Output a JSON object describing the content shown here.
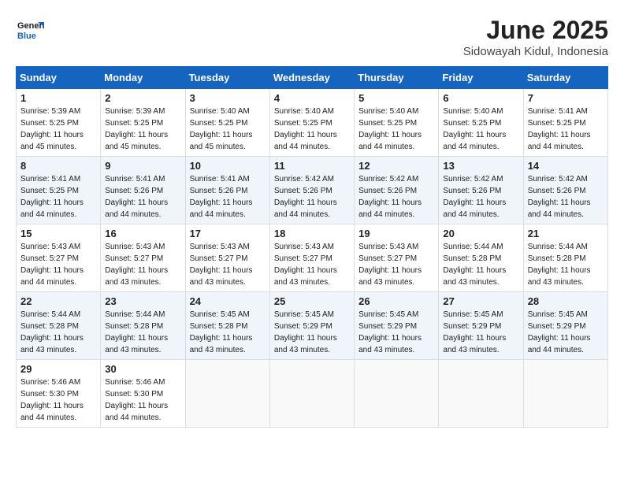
{
  "header": {
    "logo_line1": "General",
    "logo_line2": "Blue",
    "month": "June 2025",
    "location": "Sidowayah Kidul, Indonesia"
  },
  "weekdays": [
    "Sunday",
    "Monday",
    "Tuesday",
    "Wednesday",
    "Thursday",
    "Friday",
    "Saturday"
  ],
  "weeks": [
    [
      {
        "day": "1",
        "sunrise": "5:39 AM",
        "sunset": "5:25 PM",
        "daylight": "11 hours and 45 minutes."
      },
      {
        "day": "2",
        "sunrise": "5:39 AM",
        "sunset": "5:25 PM",
        "daylight": "11 hours and 45 minutes."
      },
      {
        "day": "3",
        "sunrise": "5:40 AM",
        "sunset": "5:25 PM",
        "daylight": "11 hours and 45 minutes."
      },
      {
        "day": "4",
        "sunrise": "5:40 AM",
        "sunset": "5:25 PM",
        "daylight": "11 hours and 44 minutes."
      },
      {
        "day": "5",
        "sunrise": "5:40 AM",
        "sunset": "5:25 PM",
        "daylight": "11 hours and 44 minutes."
      },
      {
        "day": "6",
        "sunrise": "5:40 AM",
        "sunset": "5:25 PM",
        "daylight": "11 hours and 44 minutes."
      },
      {
        "day": "7",
        "sunrise": "5:41 AM",
        "sunset": "5:25 PM",
        "daylight": "11 hours and 44 minutes."
      }
    ],
    [
      {
        "day": "8",
        "sunrise": "5:41 AM",
        "sunset": "5:25 PM",
        "daylight": "11 hours and 44 minutes."
      },
      {
        "day": "9",
        "sunrise": "5:41 AM",
        "sunset": "5:26 PM",
        "daylight": "11 hours and 44 minutes."
      },
      {
        "day": "10",
        "sunrise": "5:41 AM",
        "sunset": "5:26 PM",
        "daylight": "11 hours and 44 minutes."
      },
      {
        "day": "11",
        "sunrise": "5:42 AM",
        "sunset": "5:26 PM",
        "daylight": "11 hours and 44 minutes."
      },
      {
        "day": "12",
        "sunrise": "5:42 AM",
        "sunset": "5:26 PM",
        "daylight": "11 hours and 44 minutes."
      },
      {
        "day": "13",
        "sunrise": "5:42 AM",
        "sunset": "5:26 PM",
        "daylight": "11 hours and 44 minutes."
      },
      {
        "day": "14",
        "sunrise": "5:42 AM",
        "sunset": "5:26 PM",
        "daylight": "11 hours and 44 minutes."
      }
    ],
    [
      {
        "day": "15",
        "sunrise": "5:43 AM",
        "sunset": "5:27 PM",
        "daylight": "11 hours and 44 minutes."
      },
      {
        "day": "16",
        "sunrise": "5:43 AM",
        "sunset": "5:27 PM",
        "daylight": "11 hours and 43 minutes."
      },
      {
        "day": "17",
        "sunrise": "5:43 AM",
        "sunset": "5:27 PM",
        "daylight": "11 hours and 43 minutes."
      },
      {
        "day": "18",
        "sunrise": "5:43 AM",
        "sunset": "5:27 PM",
        "daylight": "11 hours and 43 minutes."
      },
      {
        "day": "19",
        "sunrise": "5:43 AM",
        "sunset": "5:27 PM",
        "daylight": "11 hours and 43 minutes."
      },
      {
        "day": "20",
        "sunrise": "5:44 AM",
        "sunset": "5:28 PM",
        "daylight": "11 hours and 43 minutes."
      },
      {
        "day": "21",
        "sunrise": "5:44 AM",
        "sunset": "5:28 PM",
        "daylight": "11 hours and 43 minutes."
      }
    ],
    [
      {
        "day": "22",
        "sunrise": "5:44 AM",
        "sunset": "5:28 PM",
        "daylight": "11 hours and 43 minutes."
      },
      {
        "day": "23",
        "sunrise": "5:44 AM",
        "sunset": "5:28 PM",
        "daylight": "11 hours and 43 minutes."
      },
      {
        "day": "24",
        "sunrise": "5:45 AM",
        "sunset": "5:28 PM",
        "daylight": "11 hours and 43 minutes."
      },
      {
        "day": "25",
        "sunrise": "5:45 AM",
        "sunset": "5:29 PM",
        "daylight": "11 hours and 43 minutes."
      },
      {
        "day": "26",
        "sunrise": "5:45 AM",
        "sunset": "5:29 PM",
        "daylight": "11 hours and 43 minutes."
      },
      {
        "day": "27",
        "sunrise": "5:45 AM",
        "sunset": "5:29 PM",
        "daylight": "11 hours and 43 minutes."
      },
      {
        "day": "28",
        "sunrise": "5:45 AM",
        "sunset": "5:29 PM",
        "daylight": "11 hours and 44 minutes."
      }
    ],
    [
      {
        "day": "29",
        "sunrise": "5:46 AM",
        "sunset": "5:30 PM",
        "daylight": "11 hours and 44 minutes."
      },
      {
        "day": "30",
        "sunrise": "5:46 AM",
        "sunset": "5:30 PM",
        "daylight": "11 hours and 44 minutes."
      },
      null,
      null,
      null,
      null,
      null
    ]
  ]
}
